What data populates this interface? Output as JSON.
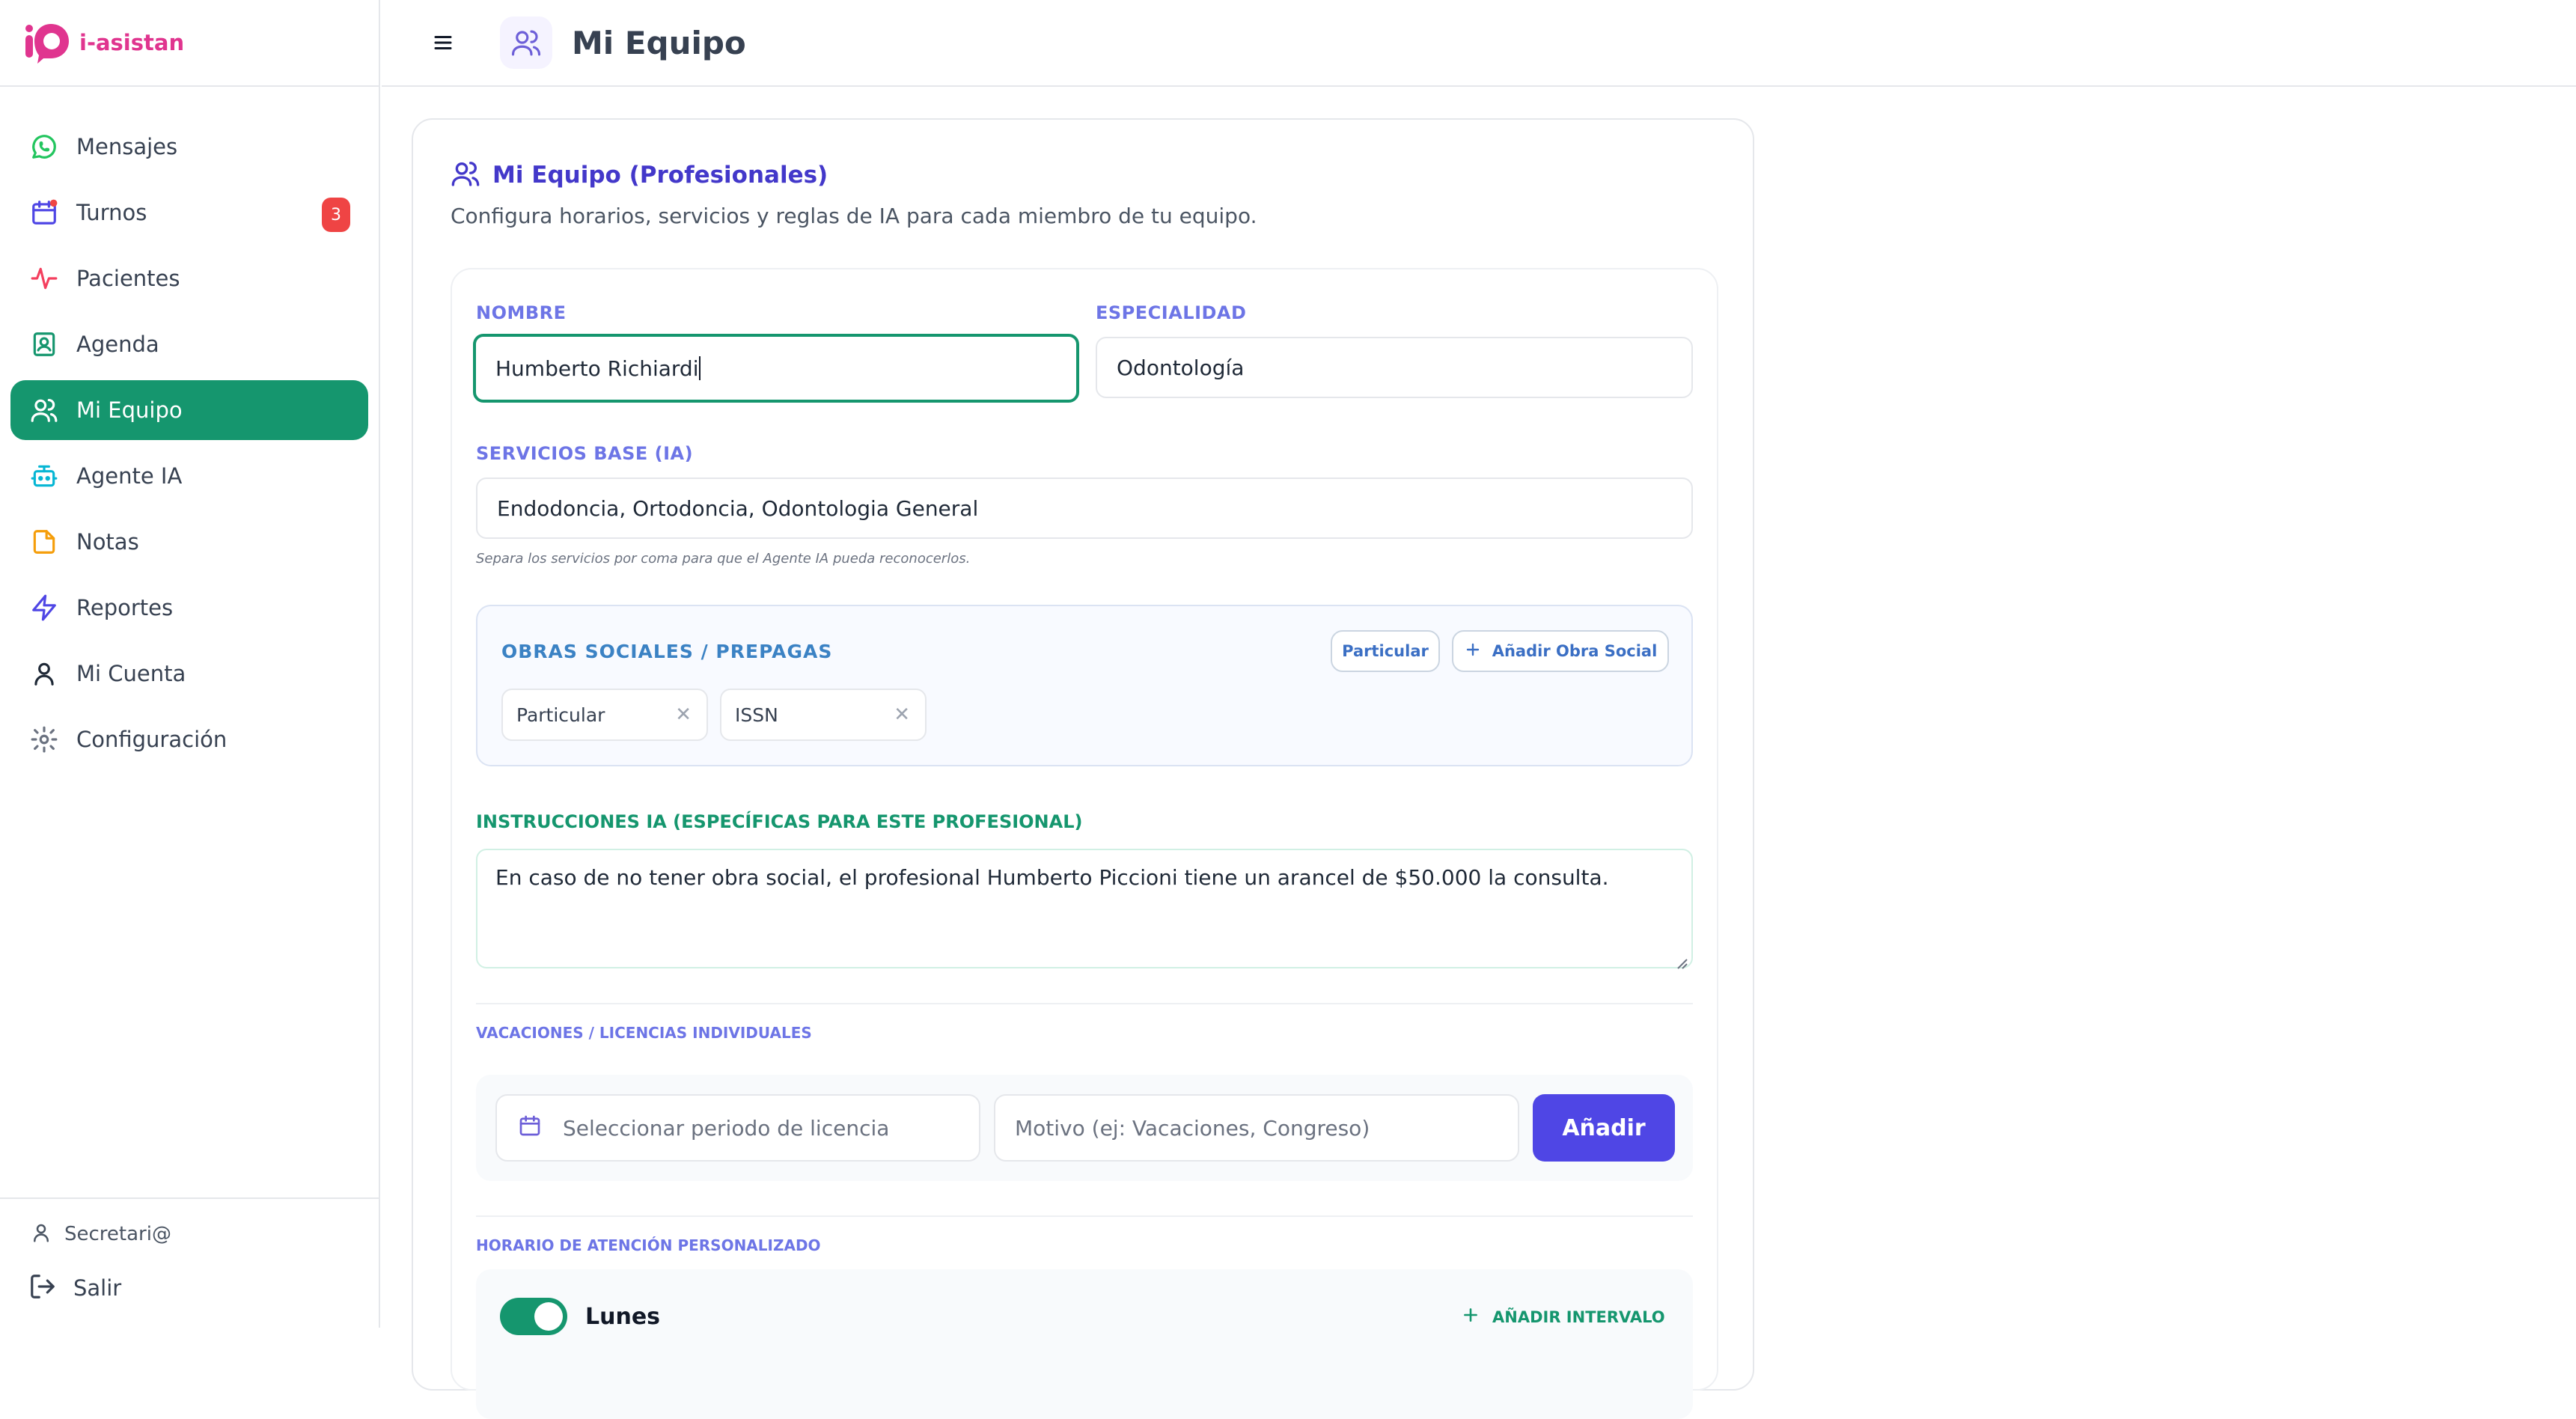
{
  "brand": {
    "name": "i-asistan",
    "accent": "#e0358f"
  },
  "nav": {
    "items": [
      {
        "label": "Mensajes",
        "icon": "whatsapp-icon"
      },
      {
        "label": "Turnos",
        "icon": "calendar-icon",
        "badge": "3"
      },
      {
        "label": "Pacientes",
        "icon": "activity-icon"
      },
      {
        "label": "Agenda",
        "icon": "contact-book-icon"
      },
      {
        "label": "Mi Equipo",
        "icon": "users-icon",
        "active": true
      },
      {
        "label": "Agente IA",
        "icon": "bot-icon"
      },
      {
        "label": "Notas",
        "icon": "note-icon"
      },
      {
        "label": "Reportes",
        "icon": "lightning-icon"
      },
      {
        "label": "Mi Cuenta",
        "icon": "user-icon"
      },
      {
        "label": "Configuración",
        "icon": "gear-icon"
      }
    ]
  },
  "sidebar_footer": {
    "user": "Secretari@",
    "logout": "Salir"
  },
  "header": {
    "title": "Mi Equipo"
  },
  "card": {
    "title": "Mi Equipo (Profesionales)",
    "subtitle": "Configura horarios, servicios y reglas de IA para cada miembro de tu equipo."
  },
  "form": {
    "name_label": "NOMBRE",
    "name_value": "Humberto Richiardi",
    "specialty_label": "ESPECIALIDAD",
    "specialty_value": "Odontología",
    "services_label": "SERVICIOS BASE (IA)",
    "services_value": "Endodoncia, Ortodoncia, Odontologia General",
    "services_hint": "Separa los servicios por coma para que el Agente IA pueda reconocerlos."
  },
  "insurance": {
    "title": "OBRAS SOCIALES / PREPAGAS",
    "quick_button": "Particular",
    "add_button": "Añadir Obra Social",
    "tags": [
      "Particular",
      "ISSN"
    ]
  },
  "ia_instructions": {
    "label": "INSTRUCCIONES IA (ESPECÍFICAS PARA ESTE PROFESIONAL)",
    "value": "En caso de no tener obra social, el profesional Humberto Piccioni tiene un arancel de $50.000 la consulta."
  },
  "vacations": {
    "label": "VACACIONES / LICENCIAS INDIVIDUALES",
    "period_placeholder": "Seleccionar periodo de licencia",
    "reason_placeholder": "Motivo (ej: Vacaciones, Congreso)",
    "add_button": "Añadir"
  },
  "schedule": {
    "label": "HORARIO DE ATENCIÓN PERSONALIZADO",
    "day": "Lunes",
    "day_enabled": true,
    "add_interval": "AÑADIR INTERVALO"
  },
  "colors": {
    "primary": "#15966e",
    "indigo": "#4f46e5",
    "danger": "#ef4444"
  }
}
